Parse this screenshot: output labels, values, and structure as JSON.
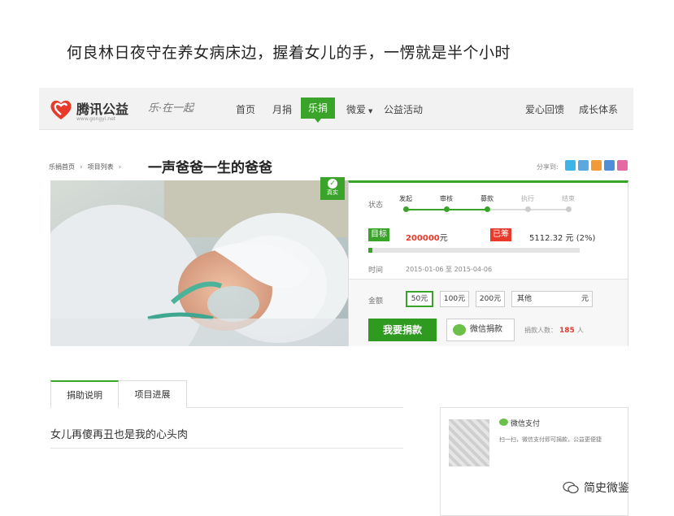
{
  "caption": "何良林日夜守在养女病床边，握着女儿的手，一愣就是半个小时",
  "header": {
    "logo_text": "腾讯公益",
    "logo_sub": "www.gongyi.net",
    "signature": "乐·在一起",
    "nav": [
      "首页",
      "月捐",
      "乐捐",
      "微爱",
      "公益活动"
    ],
    "nav_active": "乐捐",
    "right_links": [
      "爱心回馈",
      "成长体系"
    ]
  },
  "breadcrumb": {
    "items": [
      "乐捐首页",
      "项目列表"
    ],
    "title": "一声爸爸一生的爸爸"
  },
  "share": {
    "label": "分享到:"
  },
  "badge": {
    "label": "真实"
  },
  "project": {
    "status_label": "状态",
    "stages": [
      "发起",
      "审核",
      "募款",
      "执行",
      "结束"
    ],
    "current_stage_index": 2,
    "goal_tag": "目标",
    "goal_amount": "200000",
    "goal_unit": "元",
    "raised_tag": "已筹",
    "raised_amount": "5112.32 元 (2%)",
    "progress_fraction": 0.02,
    "time_label": "时间",
    "time_range": "2015-01-06 至 2015-04-06",
    "amount_label": "金额",
    "amounts": [
      "50元",
      "100元",
      "200元"
    ],
    "selected_amount_index": 0,
    "other_label": "其他",
    "other_unit": "元",
    "donate_button": "我要捐款",
    "wechat_button": "微信捐款",
    "donors_label": "捐款人数：",
    "donors_count": "185",
    "donors_unit": "人"
  },
  "tabs": [
    "捐助说明",
    "项目进展"
  ],
  "section_heading": "女儿再傻再丑也是我的心头肉",
  "wechat_card": {
    "title": "微信支付",
    "desc": "扫一扫，微信支付即可捐款，公益更便捷"
  },
  "watermark": "简史微鉴",
  "colors": {
    "accent": "#3aa42a",
    "danger": "#e8392b"
  }
}
